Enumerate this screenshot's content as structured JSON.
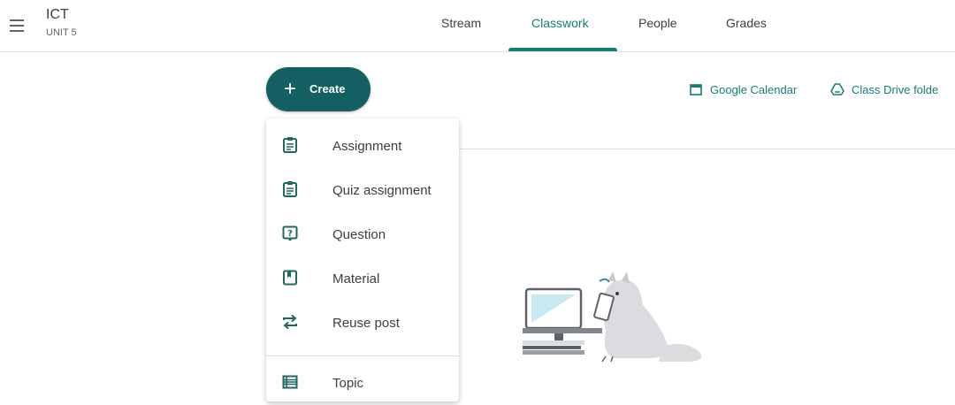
{
  "header": {
    "class_name": "ICT",
    "class_section": "UNIT 5",
    "menu_icon": "hamburger-icon",
    "tabs": [
      {
        "label": "Stream"
      },
      {
        "label": "Classwork"
      },
      {
        "label": "People"
      },
      {
        "label": "Grades"
      }
    ],
    "active_tab": "Classwork"
  },
  "toolbar": {
    "create_label": "Create",
    "create_icon": "plus-icon",
    "calendar_link": "Google Calendar",
    "drive_link": "Class Drive folde"
  },
  "create_menu": {
    "items": [
      {
        "label": "Assignment",
        "icon": "assignment-icon"
      },
      {
        "label": "Quiz assignment",
        "icon": "quiz-assignment-icon"
      },
      {
        "label": "Question",
        "icon": "question-icon"
      },
      {
        "label": "Material",
        "icon": "material-icon"
      },
      {
        "label": "Reuse post",
        "icon": "reuse-icon"
      },
      {
        "label": "Topic",
        "icon": "topic-icon"
      }
    ]
  },
  "colors": {
    "accent": "#137e73",
    "create_button": "#145f62",
    "icon": "#1e6b5c"
  }
}
